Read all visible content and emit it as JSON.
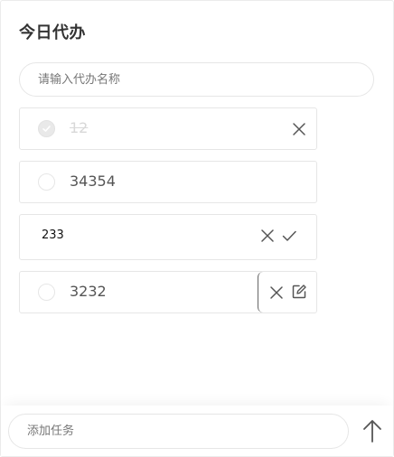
{
  "header": {
    "title": "今日代办"
  },
  "search": {
    "placeholder": "请输入代办名称"
  },
  "todos": [
    {
      "label": "12",
      "completed": true,
      "actions": [
        "close-icon"
      ]
    },
    {
      "label": "34354",
      "completed": false,
      "actions": []
    },
    {
      "label": "233",
      "editing": true,
      "actions": [
        "close-icon",
        "check-icon"
      ]
    },
    {
      "label": "3232",
      "completed": false,
      "actions": [
        "close-icon",
        "edit-icon"
      ]
    }
  ],
  "footer": {
    "add_placeholder": "添加任务",
    "send_icon": "arrow-up-icon"
  },
  "colors": {
    "border": "#e6e6e6",
    "text": "#555555",
    "done_text": "#d8d8d8",
    "icon": "#555555"
  }
}
